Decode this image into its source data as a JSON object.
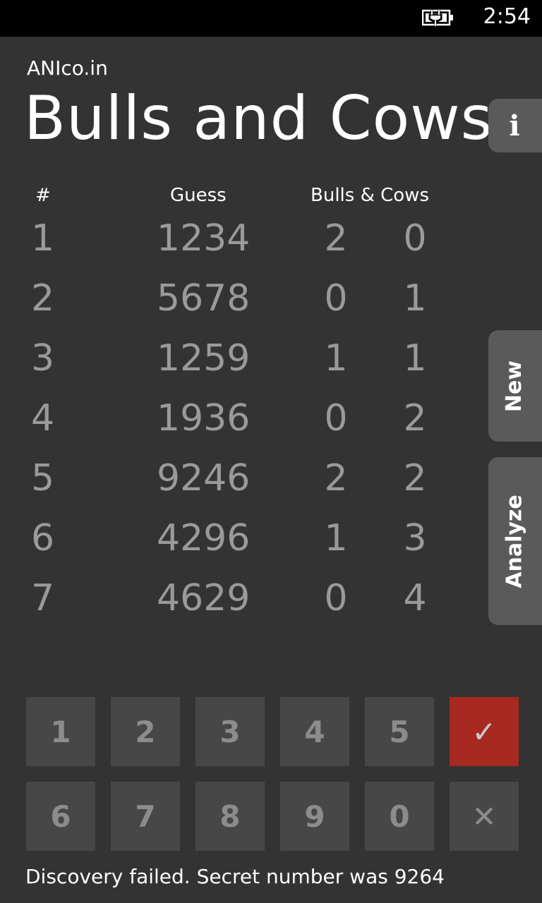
{
  "status_bar": {
    "battery_icon": "battery-charging-icon",
    "time": "2:54"
  },
  "header": {
    "subtitle": "ANIco.in",
    "title": "Bulls and Cows"
  },
  "side_tabs": {
    "info": "i",
    "new": "New",
    "analyze": "Analyze"
  },
  "table": {
    "columns": {
      "number": "#",
      "guess": "Guess",
      "bulls_cows": "Bulls & Cows"
    },
    "rows": [
      {
        "number": "1",
        "guess": "1234",
        "bulls": "2",
        "cows": "0"
      },
      {
        "number": "2",
        "guess": "5678",
        "bulls": "0",
        "cows": "1"
      },
      {
        "number": "3",
        "guess": "1259",
        "bulls": "1",
        "cows": "1"
      },
      {
        "number": "4",
        "guess": "1936",
        "bulls": "0",
        "cows": "2"
      },
      {
        "number": "5",
        "guess": "9246",
        "bulls": "2",
        "cows": "2"
      },
      {
        "number": "6",
        "guess": "4296",
        "bulls": "1",
        "cows": "3"
      },
      {
        "number": "7",
        "guess": "4629",
        "bulls": "0",
        "cows": "4"
      }
    ]
  },
  "keypad": {
    "row1": [
      "1",
      "2",
      "3",
      "4",
      "5"
    ],
    "row2": [
      "6",
      "7",
      "8",
      "9",
      "0"
    ],
    "submit_glyph": "✓",
    "clear_glyph": "✕",
    "submit_color": "#a7291f"
  },
  "message": "Discovery failed. Secret number was 9264"
}
